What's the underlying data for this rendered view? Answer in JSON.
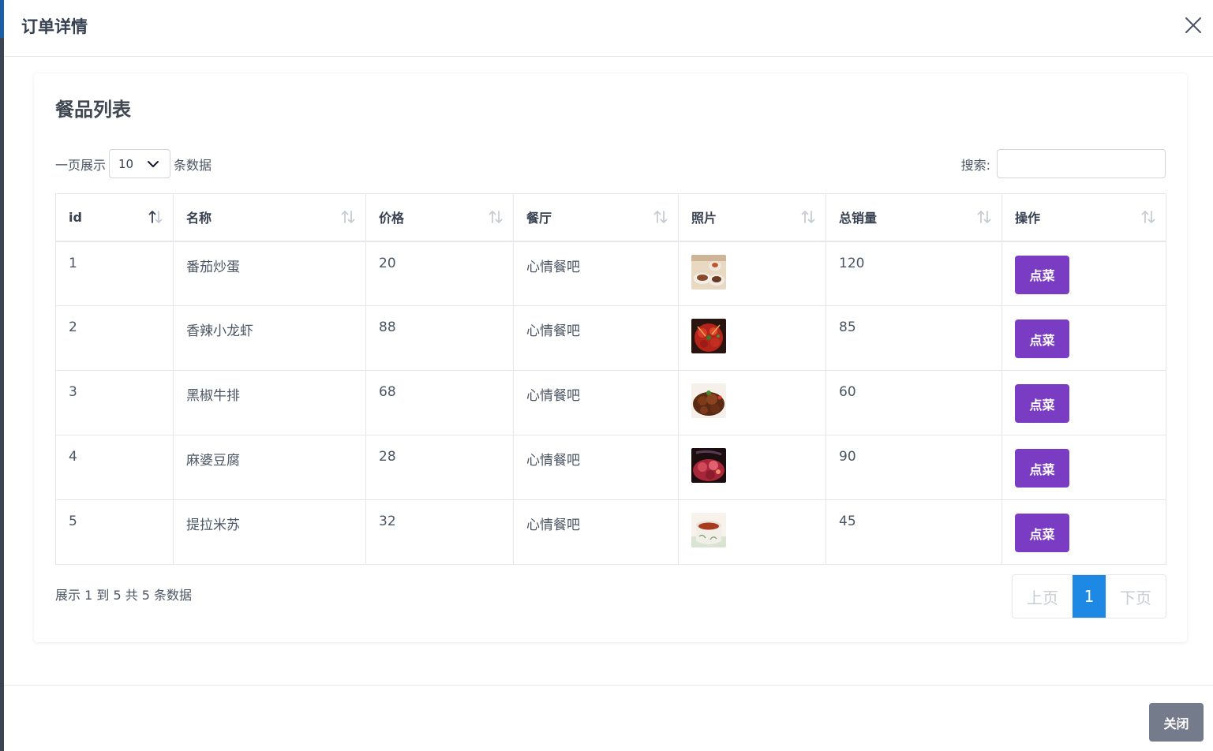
{
  "modal": {
    "title": "订单详情",
    "close_label": "关闭"
  },
  "card": {
    "title": "餐品列表"
  },
  "length": {
    "prefix": "一页展示",
    "value": "10",
    "suffix": "条数据"
  },
  "search": {
    "label": "搜索:",
    "value": ""
  },
  "table": {
    "columns": [
      "id",
      "名称",
      "价格",
      "餐厅",
      "照片",
      "总销量",
      "操作"
    ],
    "rows": [
      {
        "id": "1",
        "name": "番茄炒蛋",
        "price": "20",
        "restaurant": "心情餐吧",
        "photo": "photo-tomato-egg",
        "sales": "120",
        "action": "点菜"
      },
      {
        "id": "2",
        "name": "香辣小龙虾",
        "price": "88",
        "restaurant": "心情餐吧",
        "photo": "photo-crayfish",
        "sales": "85",
        "action": "点菜"
      },
      {
        "id": "3",
        "name": "黑椒牛排",
        "price": "68",
        "restaurant": "心情餐吧",
        "photo": "photo-steak",
        "sales": "60",
        "action": "点菜"
      },
      {
        "id": "4",
        "name": "麻婆豆腐",
        "price": "28",
        "restaurant": "心情餐吧",
        "photo": "photo-tofu",
        "sales": "90",
        "action": "点菜"
      },
      {
        "id": "5",
        "name": "提拉米苏",
        "price": "32",
        "restaurant": "心情餐吧",
        "photo": "photo-tiramisu",
        "sales": "45",
        "action": "点菜"
      }
    ]
  },
  "info": "展示 1 到 5 共 5 条数据",
  "pagination": {
    "prev": "上页",
    "current": "1",
    "next": "下页"
  },
  "colors": {
    "accent": "#7a3cc2",
    "page_active": "#1e88e5",
    "close_button": "#747b8b"
  }
}
